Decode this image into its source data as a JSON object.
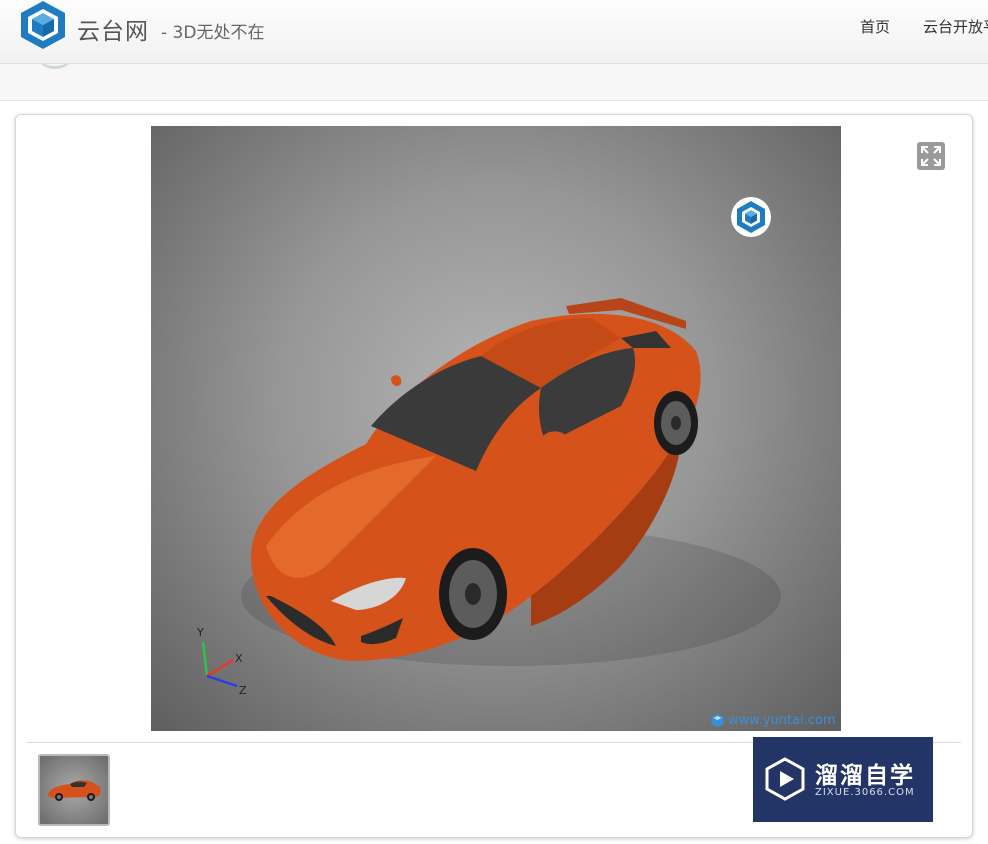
{
  "header": {
    "site_name": "云台网",
    "tagline": "- 3D无处不在",
    "logo_icon": "cube-icon",
    "nav": [
      {
        "label": "首页"
      },
      {
        "label": "云台开放平"
      }
    ]
  },
  "viewer": {
    "model": "orange sports car",
    "axis_labels": {
      "x": "X",
      "y": "Y",
      "z": "Z"
    },
    "watermark_url": "www.yuntai.com",
    "brand_badge_icon": "cube-icon",
    "fullscreen_icon": "expand-icon"
  },
  "thumbnails": [
    {
      "label": "orange sports car thumbnail",
      "selected": true
    }
  ],
  "promo": {
    "title": "溜溜自学",
    "subtitle": "ZIXUE.3066.COM",
    "icon": "play-icon"
  },
  "colors": {
    "brand_blue": "#1f7cc1",
    "car_orange": "#d5531b",
    "promo_bg": "#223566",
    "link_blue": "#3a8fd9"
  }
}
